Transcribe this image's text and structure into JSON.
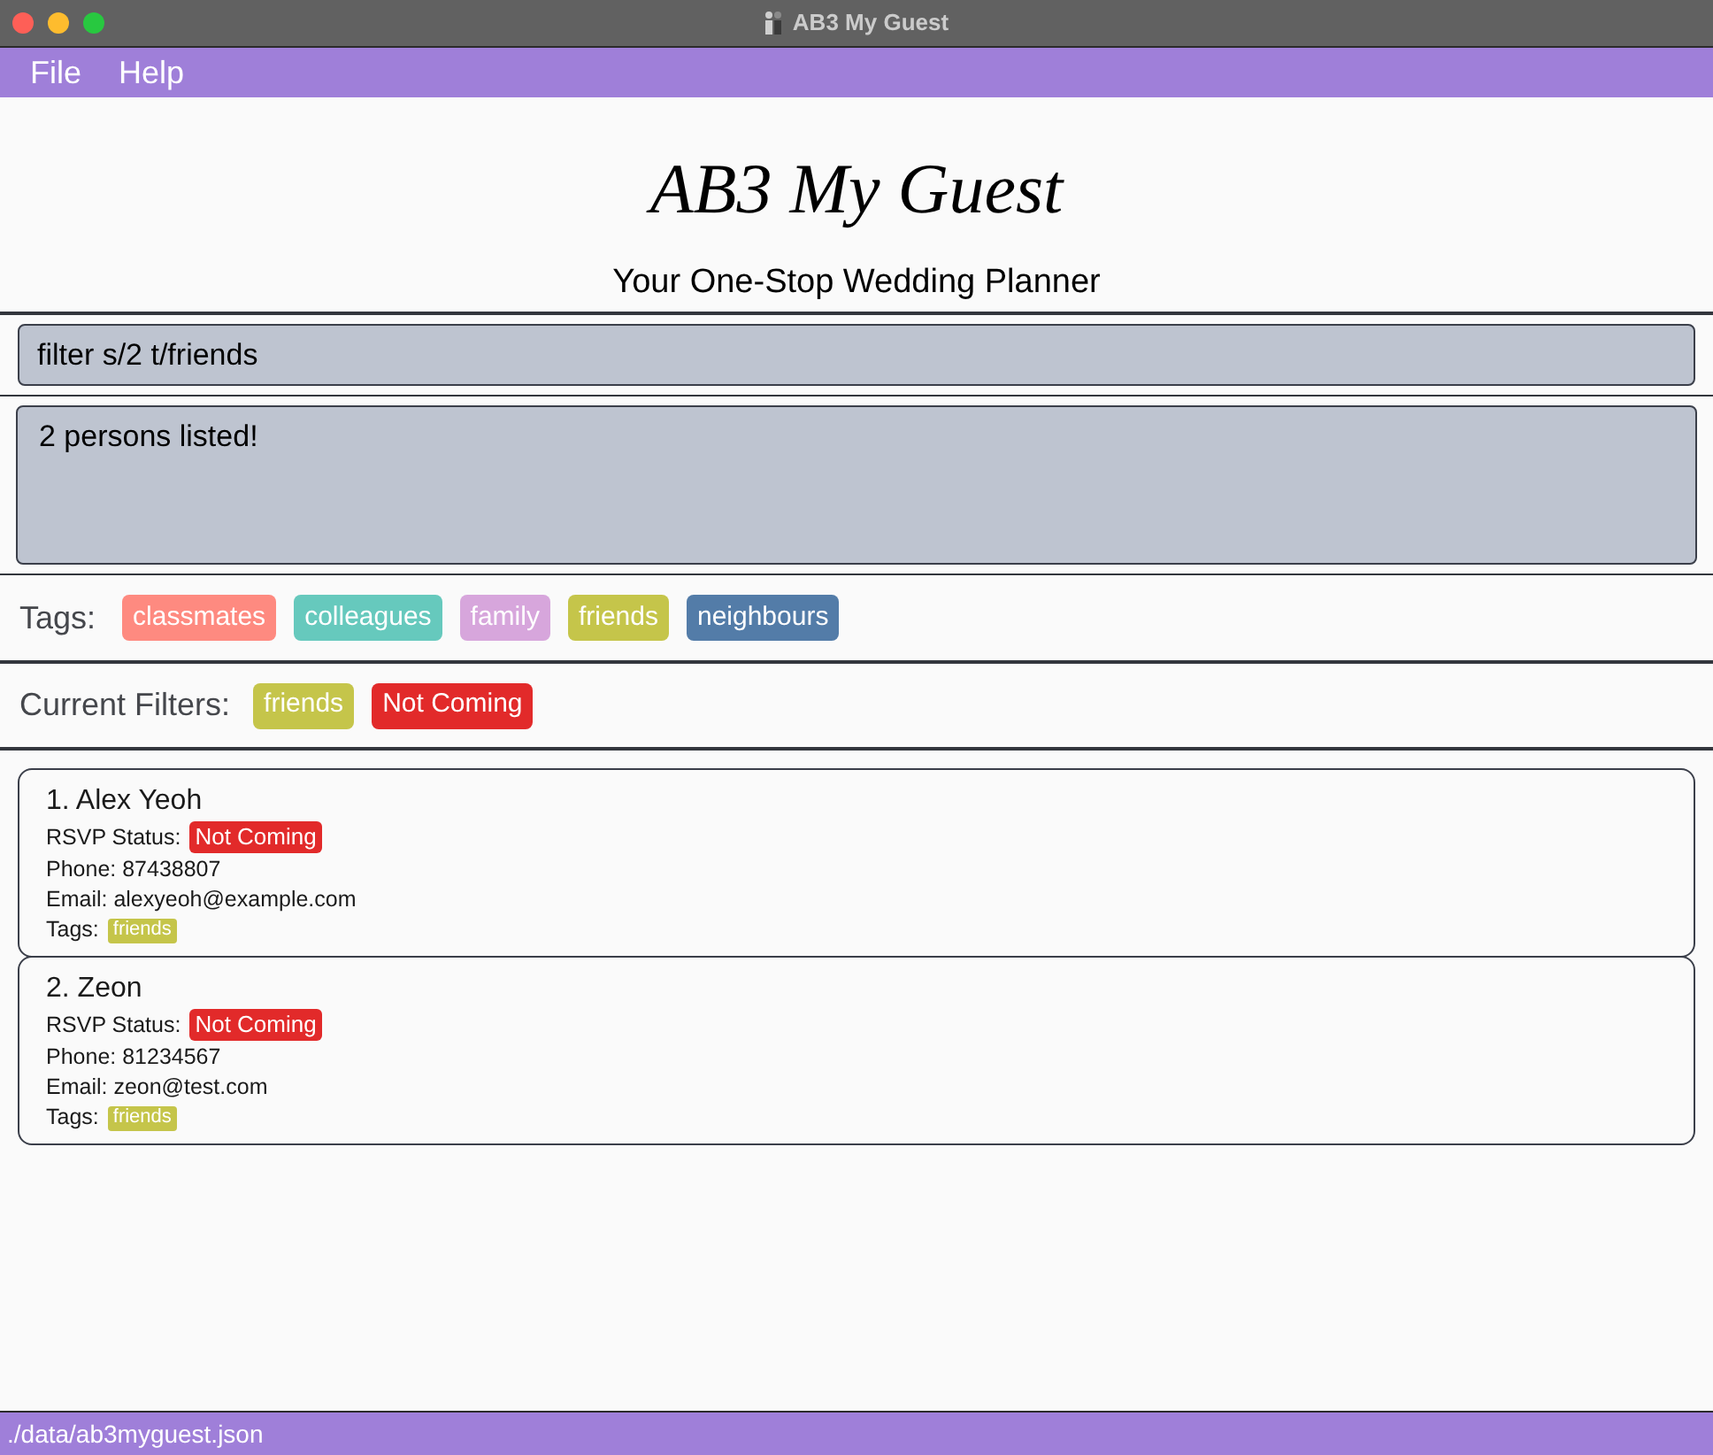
{
  "window": {
    "title": "AB3 My Guest"
  },
  "menu": [
    {
      "label": "File"
    },
    {
      "label": "Help"
    }
  ],
  "header": {
    "title": "AB3 My Guest",
    "subtitle": "Your One-Stop Wedding Planner"
  },
  "command_box": {
    "value": "filter s/2 t/friends"
  },
  "result_display": {
    "text": "2 persons listed!"
  },
  "tags_panel": {
    "label": "Tags:",
    "tags": [
      {
        "label": "classmates",
        "color": "#fe8a80"
      },
      {
        "label": "colleagues",
        "color": "#66c9bd"
      },
      {
        "label": "family",
        "color": "#d7a6dc"
      },
      {
        "label": "friends",
        "color": "#c5c54a"
      },
      {
        "label": "neighbours",
        "color": "#537ca8"
      }
    ]
  },
  "filters_panel": {
    "label": "Current Filters:",
    "filters": [
      {
        "label": "friends",
        "color": "#c5c54a"
      },
      {
        "label": "Not Coming",
        "color": "#e22a2a"
      }
    ]
  },
  "persons": [
    {
      "name": "1. Alex Yeoh",
      "rsvp_label": "RSVP Status:",
      "rsvp": {
        "label": "Not Coming",
        "color": "#e22a2a"
      },
      "phone": "Phone: 87438807",
      "email": "Email: alexyeoh@example.com",
      "tags_label": "Tags:",
      "tags": [
        {
          "label": "friends",
          "color": "#c5c54a"
        }
      ]
    },
    {
      "name": "2. Zeon",
      "rsvp_label": "RSVP Status:",
      "rsvp": {
        "label": "Not Coming",
        "color": "#e22a2a"
      },
      "phone": "Phone: 81234567",
      "email": "Email: zeon@test.com",
      "tags_label": "Tags:",
      "tags": [
        {
          "label": "friends",
          "color": "#c5c54a"
        }
      ]
    }
  ],
  "status_bar": {
    "path": "./data/ab3myguest.json"
  }
}
